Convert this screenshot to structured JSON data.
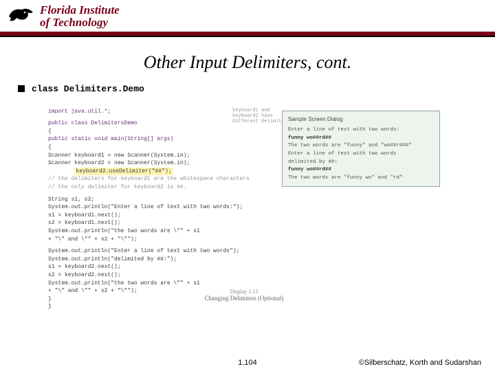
{
  "header": {
    "institution_line1": "Florida Institute",
    "institution_line2": "of Technology"
  },
  "title": "Other Input Delimiters, cont.",
  "bullet": {
    "text": "class Delimiters.Demo"
  },
  "code": {
    "l1": "import java.util.*;",
    "l2": "public class DelimitersDemo",
    "l3": "{",
    "l4": "    public static void main(String[] args)",
    "l5": "    {",
    "l6": "        Scanner keyboard1 = new Scanner(System.in);",
    "l7": "        Scanner keyboard2 = new Scanner(System.in);",
    "l8": "        keyboard2.useDelimiter(\"##\");",
    "l9": "        // the delimiters for keyboard1 are the whitespace characters",
    "l10": "        // the only delimiter for keyboard2 is ##.",
    "l11": "        String s1, s2;",
    "l12": "        System.out.println(\"Enter a line of text with two words:\");",
    "l13": "        s1 = keyboard1.next();",
    "l14": "        s2 = keyboard1.next();",
    "l15": "        System.out.println(\"the two words are \\\"\" + s1",
    "l16": "                           + \"\\\" and \\\"\" + s2 + \"\\\"\");",
    "l17": "        System.out.println(\"Enter a line of text with two words\");",
    "l18": "        System.out.println(\"delimited by ##:\");",
    "l19": "        s1 = keyboard2.next();",
    "l20": "        s2 = keyboard2.next();",
    "l21": "        System.out.println(\"the two words are \\\"\" + s1",
    "l22": "                           + \"\\\" and \\\"\" + s2 + \"\\\"\");",
    "l23": "    }",
    "l24": "}"
  },
  "note": {
    "l1": "keyboard1 and",
    "l2": "keyboard2 have",
    "l3": "different delimiters."
  },
  "dialog": {
    "title": "Sample Screen Dialog",
    "l1": "Enter a line of text with two words:",
    "l2": "funny wo##rd##",
    "l3": "The two words are \"funny\" and \"wo##rd##\"",
    "l4": "Enter a line of text with two words",
    "l5": "delimited by ##:",
    "l6": "funny wo##rd##",
    "l7": "The two words are \"funny wo\" and \"rd\""
  },
  "caption": {
    "display": "Display 2.13",
    "text": "Changing Delimiters (Optional)"
  },
  "footer": {
    "page": "1.104",
    "copyright": "©Silberschatz, Korth and Sudarshan"
  }
}
